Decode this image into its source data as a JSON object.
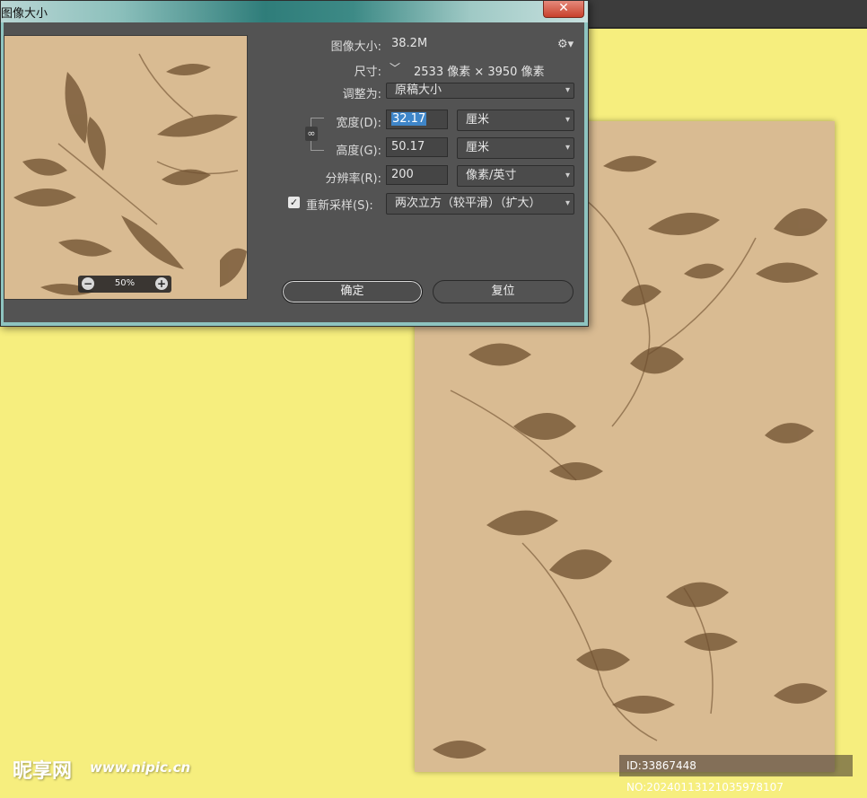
{
  "dialog": {
    "title": "图像大小",
    "close_glyph": "✕",
    "image_size_label": "图像大小:",
    "image_size_value": "38.2M",
    "settings_icon": "gear-icon",
    "dimensions_label": "尺寸:",
    "dimensions_value": "2533 像素 × 3950 像素",
    "fit_to_label": "调整为:",
    "fit_to_value": "原稿大小",
    "width_label": "宽度(D):",
    "width_value": "32.17",
    "width_unit": "厘米",
    "height_label": "高度(G):",
    "height_value": "50.17",
    "height_unit": "厘米",
    "resolution_label": "分辨率(R):",
    "resolution_value": "200",
    "resolution_unit": "像素/英寸",
    "resample_label": "重新采样(S):",
    "resample_checked": true,
    "resample_value": "两次立方（较平滑）（扩大）",
    "zoom_value": "50%",
    "ok_label": "确定",
    "reset_label": "复位"
  },
  "watermark": {
    "logo_text": "昵享网",
    "site_text": "www.nipic.cn",
    "id_text": "ID:33867448 NO:20240113121035978107"
  },
  "colors": {
    "workspace_bg": "#f6ee7e",
    "canvas_bg": "#d9bb92",
    "dialog_bg": "#535353",
    "pattern_ink": "#6e4f2f"
  }
}
